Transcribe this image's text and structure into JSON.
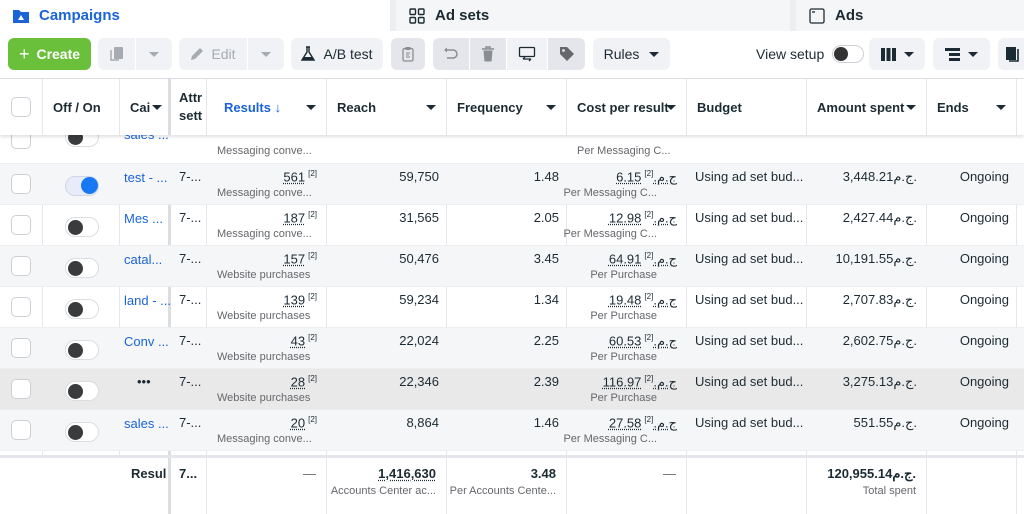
{
  "tabs": {
    "campaigns": {
      "label": "Campaigns",
      "icon": "folder-icon"
    },
    "adsets": {
      "label": "Ad sets",
      "icon": "grid-icon"
    },
    "ads": {
      "label": "Ads",
      "icon": "window-icon"
    }
  },
  "toolbar": {
    "create_label": "Create",
    "edit_label": "Edit",
    "ab_test_label": "A/B test",
    "rules_label": "Rules",
    "view_setup_label": "View setup",
    "view_setup_on": false
  },
  "colors": {
    "accent": "#1a64d8",
    "create_button": "#6abf3b",
    "toggle_on": "#1877f2"
  },
  "table": {
    "columns": [
      {
        "key": "select",
        "label": ""
      },
      {
        "key": "toggle",
        "label": "Off / On"
      },
      {
        "key": "campaign",
        "label": "Cai"
      },
      {
        "key": "attribution",
        "label": "Attr sett"
      },
      {
        "key": "results",
        "label": "Results ↓"
      },
      {
        "key": "reach",
        "label": "Reach"
      },
      {
        "key": "frequency",
        "label": "Frequency"
      },
      {
        "key": "cost_per_result",
        "label": "Cost per result"
      },
      {
        "key": "budget",
        "label": "Budget"
      },
      {
        "key": "amount_spent",
        "label": "Amount spent"
      },
      {
        "key": "ends",
        "label": "Ends"
      }
    ],
    "partial_row": {
      "name": "sales ...",
      "results_sub": "Messaging conve...",
      "cost_sub": "Per Messaging C..."
    },
    "rows": [
      {
        "on": true,
        "name": "test - ...",
        "attr": "7-...",
        "results": "561",
        "results_sub": "Messaging conve...",
        "reach": "59,750",
        "frequency": "1.48",
        "cpr": "6.15ج.م.",
        "cpr_sub": "Per Messaging C...",
        "budget": "Using ad set bud...",
        "spent": "3,448.21ج.م.",
        "ends": "Ongoing"
      },
      {
        "on": false,
        "name": "Mes ...",
        "attr": "7-...",
        "results": "187",
        "results_sub": "Messaging conve...",
        "reach": "31,565",
        "frequency": "2.05",
        "cpr": "12.98ج.م.",
        "cpr_sub": "Per Messaging C...",
        "budget": "Using ad set bud...",
        "spent": "2,427.44ج.م.",
        "ends": "Ongoing"
      },
      {
        "on": false,
        "name": "catal...",
        "attr": "7-...",
        "results": "157",
        "results_sub": "Website purchases",
        "reach": "50,476",
        "frequency": "3.45",
        "cpr": "64.91ج.م.",
        "cpr_sub": "Per Purchase",
        "budget": "Using ad set bud...",
        "spent": "10,191.55ج.م.",
        "ends": "Ongoing"
      },
      {
        "on": false,
        "name": "land - ...",
        "attr": "7-...",
        "results": "139",
        "results_sub": "Website purchases",
        "reach": "59,234",
        "frequency": "1.34",
        "cpr": "19.48ج.م.",
        "cpr_sub": "Per Purchase",
        "budget": "Using ad set bud...",
        "spent": "2,707.83ج.م.",
        "ends": "Ongoing"
      },
      {
        "on": false,
        "name": "Conv ...",
        "attr": "7-...",
        "results": "43",
        "results_sub": "Website purchases",
        "reach": "22,024",
        "frequency": "2.25",
        "cpr": "60.53ج.م.",
        "cpr_sub": "Per Purchase",
        "budget": "Using ad set bud...",
        "spent": "2,602.75ج.م.",
        "ends": "Ongoing"
      },
      {
        "on": false,
        "name": "•••",
        "attr": "7-...",
        "results": "28",
        "results_sub": "Website purchases",
        "reach": "22,346",
        "frequency": "2.39",
        "cpr": "116.97ج.م.",
        "cpr_sub": "Per Purchase",
        "budget": "Using ad set bud...",
        "spent": "3,275.13ج.م.",
        "ends": "Ongoing"
      },
      {
        "on": false,
        "name": "sales ...",
        "attr": "7-...",
        "results": "20",
        "results_sub": "Messaging conve...",
        "reach": "8,864",
        "frequency": "1.46",
        "cpr": "27.58ج.م.",
        "cpr_sub": "Per Messaging C...",
        "budget": "Using ad set bud...",
        "spent": "551.55ج.م.",
        "ends": "Ongoing"
      }
    ],
    "superscript": "[2]",
    "footer": {
      "label": "Resul",
      "attr": "7...",
      "results": "—",
      "reach": "1,416,630",
      "reach_sub": "Accounts Center ac...",
      "frequency": "3.48",
      "frequency_sub": "Per Accounts Cente...",
      "cpr": "—",
      "spent": "120,955.14ج.م.",
      "spent_sub": "Total spent"
    }
  }
}
